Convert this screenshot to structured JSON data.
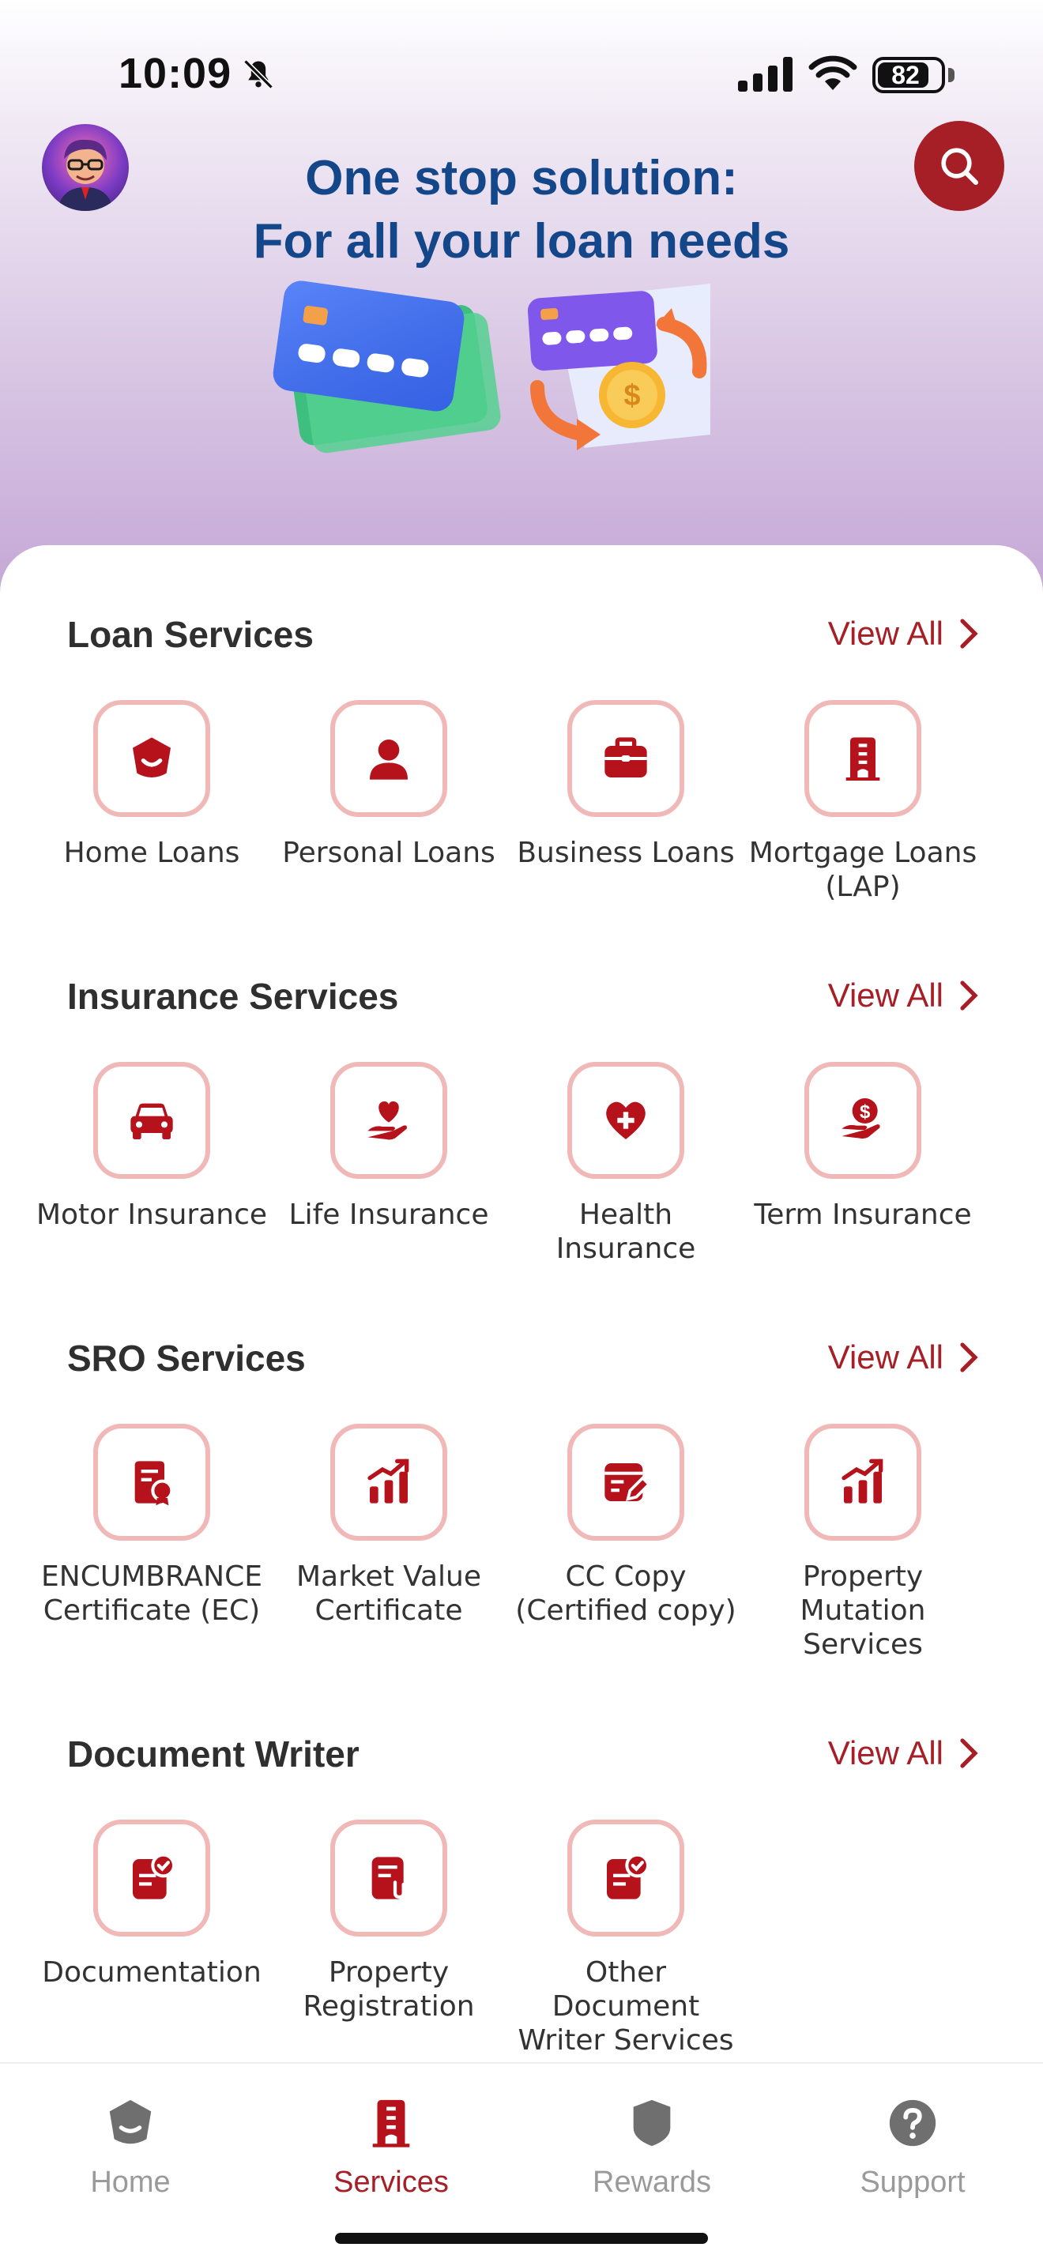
{
  "status_bar": {
    "time": "10:09",
    "battery": "82",
    "battery_level": 0.82
  },
  "banner": {
    "line1": "One stop solution:",
    "line2": "For all your loan needs"
  },
  "sections": [
    {
      "title": "Loan Services",
      "view_all": "View All",
      "items": [
        {
          "label": "Home Loans",
          "icon": "home-shield-icon"
        },
        {
          "label": "Personal Loans",
          "icon": "person-icon"
        },
        {
          "label": "Business Loans",
          "icon": "briefcase-icon"
        },
        {
          "label": "Mortgage Loans (LAP)",
          "icon": "building-icon"
        }
      ]
    },
    {
      "title": "Insurance Services",
      "view_all": "View All",
      "items": [
        {
          "label": "Motor Insurance",
          "icon": "car-icon"
        },
        {
          "label": "Life Insurance",
          "icon": "hand-heart-icon"
        },
        {
          "label": "Health Insurance",
          "icon": "heart-plus-icon"
        },
        {
          "label": "Term Insurance",
          "icon": "hand-dollar-icon"
        }
      ]
    },
    {
      "title": "SRO Services",
      "view_all": "View All",
      "items": [
        {
          "label": "ENCUMBRANCE Certificate (EC)",
          "icon": "certificate-icon"
        },
        {
          "label": "Market Value Certificate",
          "icon": "bar-chart-icon"
        },
        {
          "label": "CC Copy (Certified copy)",
          "icon": "form-edit-icon"
        },
        {
          "label": "Property Mutation Services",
          "icon": "trend-chart-icon"
        }
      ]
    },
    {
      "title": "Document Writer",
      "view_all": "View All",
      "items": [
        {
          "label": "Documentation",
          "icon": "doc-check-icon"
        },
        {
          "label": "Property Registration",
          "icon": "doc-attach-icon"
        },
        {
          "label": "Other Document Writer Services",
          "icon": "doc-check-icon"
        }
      ]
    }
  ],
  "bottom_nav": [
    {
      "label": "Home",
      "icon": "home-shield-icon",
      "active": false
    },
    {
      "label": "Services",
      "icon": "building-icon",
      "active": true
    },
    {
      "label": "Rewards",
      "icon": "badge-icon",
      "active": false
    },
    {
      "label": "Support",
      "icon": "question-icon",
      "active": false
    }
  ],
  "colors": {
    "brand": "#a61e26",
    "headline": "#14478a",
    "icon_border": "#f1b8b8"
  }
}
